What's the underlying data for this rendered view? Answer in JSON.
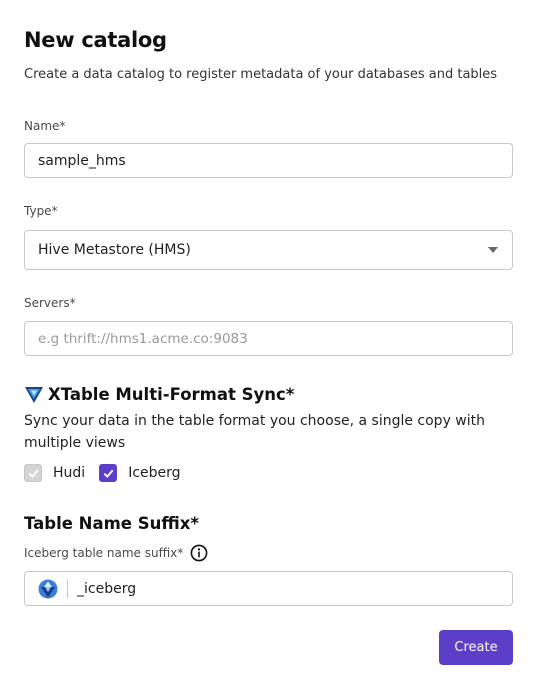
{
  "header": {
    "title": "New catalog",
    "subtitle": "Create a data catalog to register metadata of your databases and tables"
  },
  "name_field": {
    "label": "Name*",
    "value": "sample_hms"
  },
  "type_field": {
    "label": "Type*",
    "value": "Hive Metastore (HMS)"
  },
  "servers_field": {
    "label": "Servers*",
    "placeholder": "e.g thrift://hms1.acme.co:9083"
  },
  "xtable": {
    "title": "XTable Multi-Format Sync*",
    "description": "Sync your data in the table format you choose, a single copy with multiple views",
    "options": [
      {
        "label": "Hudi",
        "checked": true,
        "disabled": true
      },
      {
        "label": "Iceberg",
        "checked": true,
        "disabled": false
      }
    ]
  },
  "suffix": {
    "title": "Table Name Suffix*",
    "label": "Iceberg table name suffix*",
    "value": "_iceberg"
  },
  "actions": {
    "create_label": "Create"
  },
  "colors": {
    "accent": "#5b3fc8",
    "border": "#c9c9c9",
    "disabled_check": "#d4d4d4"
  },
  "icons": [
    "xtable-logo-icon",
    "chevron-down-icon",
    "check-icon",
    "info-icon",
    "iceberg-logo-icon"
  ]
}
